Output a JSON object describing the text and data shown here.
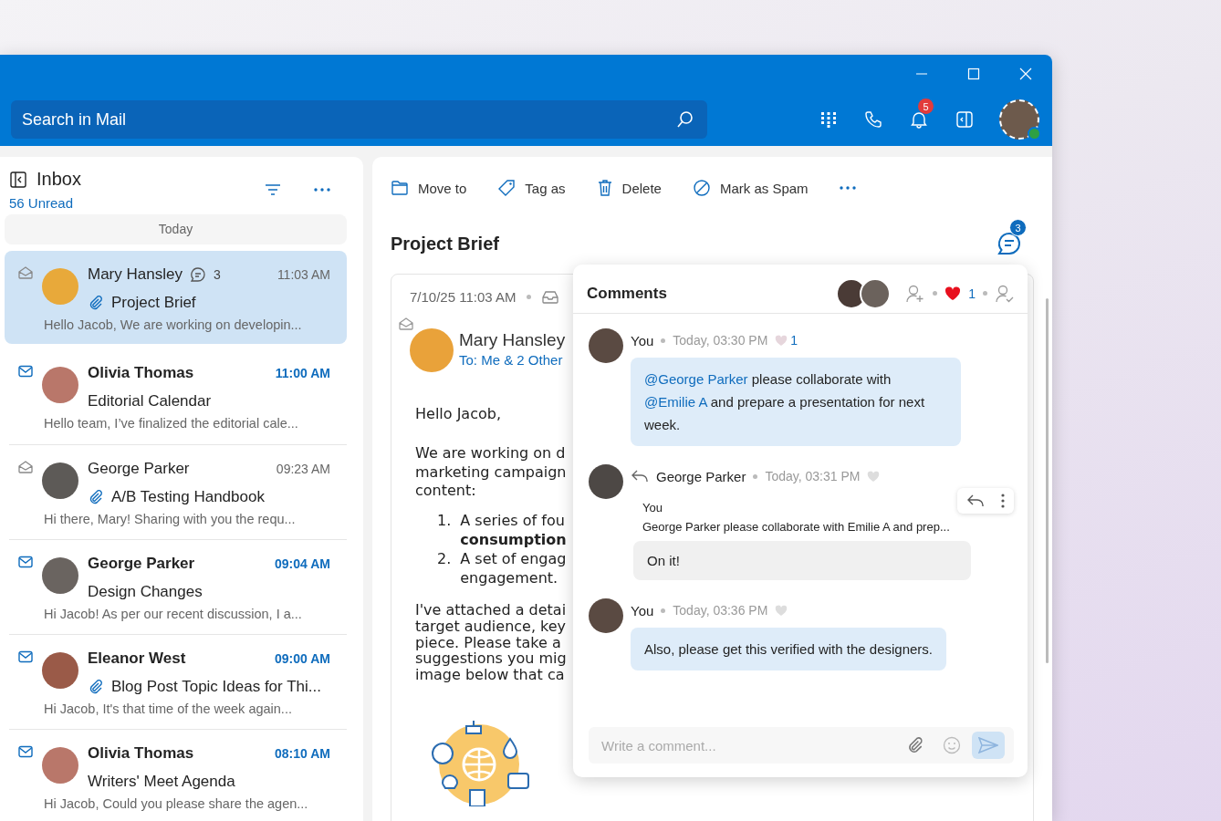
{
  "window": {
    "search": {
      "placeholder": "Search in Mail"
    },
    "notifications": {
      "count": "5"
    }
  },
  "mail_list": {
    "title": "Inbox",
    "unread": "56 Unread",
    "group": "Today",
    "items": [
      {
        "sender": "Mary Hansley",
        "comments": "3",
        "time": "11:03 AM",
        "subject": "Project Brief",
        "attachment": true,
        "preview": "Hello Jacob, We are working on developin...",
        "unread": false,
        "selected": true
      },
      {
        "sender": "Olivia Thomas",
        "time": "11:00 AM",
        "subject": "Editorial Calendar",
        "attachment": false,
        "preview": "Hello team, I’ve finalized the editorial cale...",
        "unread": true,
        "selected": false
      },
      {
        "sender": "George Parker",
        "time": "09:23 AM",
        "subject": "A/B Testing Handbook",
        "attachment": true,
        "preview": "Hi there, Mary! Sharing with you the requ...",
        "unread": false,
        "selected": false
      },
      {
        "sender": "George Parker",
        "time": "09:04 AM",
        "subject": "Design Changes",
        "attachment": false,
        "preview": "Hi Jacob! As per our recent discussion, I a...",
        "unread": true,
        "selected": false
      },
      {
        "sender": "Eleanor West",
        "time": "09:00 AM",
        "subject": "Blog Post Topic Ideas for Thi...",
        "attachment": true,
        "preview": "Hi Jacob, It's that time of the week again...",
        "unread": true,
        "selected": false
      },
      {
        "sender": "Olivia Thomas",
        "time": "08:10 AM",
        "subject": "Writers' Meet Agenda",
        "attachment": false,
        "preview": "Hi Jacob, Could you please share the agen...",
        "unread": true,
        "selected": false
      }
    ]
  },
  "toolbar": {
    "actions": [
      "Move to",
      "Tag as",
      "Delete",
      "Mark as Spam"
    ]
  },
  "message": {
    "subject": "Project Brief",
    "comment_count": "3",
    "date": "7/10/25 11:03 AM",
    "sender": "Mary Hansley",
    "recipients": "To: Me & 2 Other",
    "greeting": "Hello Jacob,",
    "intro": [
      "We are working on d",
      "marketing campaign",
      "content:"
    ],
    "list": [
      {
        "number": "1.",
        "lines": [
          "A series of fou",
          "**consumption**"
        ]
      },
      {
        "number": "2.",
        "lines": [
          "A set of engag",
          "engagement."
        ]
      }
    ],
    "closing": [
      "I've attached a detai",
      "target audience, key",
      "piece. Please take a",
      "suggestions you mig",
      "image below that ca"
    ]
  },
  "comments": {
    "title": "Comments",
    "reactions": "1",
    "items": [
      {
        "kind": "message",
        "author": "You",
        "time": "Today, 03:30 PM",
        "likes": "1",
        "own": true,
        "parts": [
          {
            "text": "@George Parker",
            "mention": true
          },
          {
            "text": " please collaborate with ",
            "mention": false
          },
          {
            "text": "@Emilie A",
            "mention": true
          },
          {
            "text": " and prepare a presentation for next week.",
            "mention": false
          }
        ]
      },
      {
        "kind": "reply",
        "author": "George Parker",
        "time": "Today, 03:31 PM",
        "quote_author": "You",
        "quote": "George Parker please collaborate with Emilie A and prep...",
        "own": false,
        "parts": [
          {
            "text": "On it!",
            "mention": false
          }
        ]
      },
      {
        "kind": "message",
        "author": "You",
        "time": "Today, 03:36 PM",
        "own": true,
        "parts": [
          {
            "text": "Also, please get this verified with the designers.",
            "mention": false
          }
        ]
      }
    ],
    "composer": {
      "placeholder": "Write a comment..."
    }
  }
}
